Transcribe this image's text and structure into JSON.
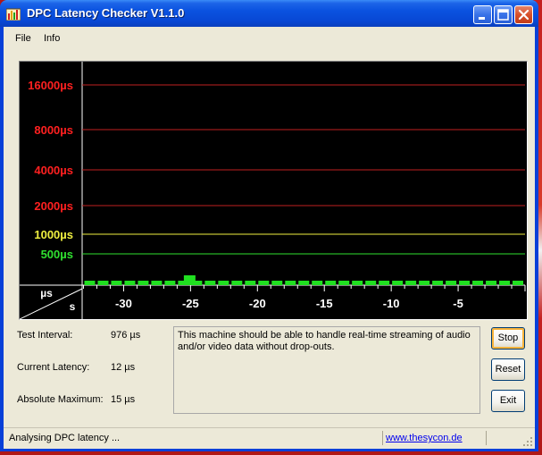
{
  "window": {
    "title": "DPC Latency Checker V1.1.0",
    "controls": [
      "minimize",
      "maximize",
      "close"
    ]
  },
  "menu": {
    "items": [
      {
        "label": "File"
      },
      {
        "label": "Info"
      }
    ]
  },
  "graph": {
    "y_levels": [
      {
        "label": "16000µs",
        "color": "#ff2020",
        "line": "#c02020"
      },
      {
        "label": "8000µs",
        "color": "#ff2020",
        "line": "#c02020"
      },
      {
        "label": "4000µs",
        "color": "#ff2020",
        "line": "#c02020"
      },
      {
        "label": "2000µs",
        "color": "#ff2020",
        "line": "#c02020"
      },
      {
        "label": "1000µs",
        "color": "#f0f040",
        "line": "#f0f040"
      },
      {
        "label": "500µs",
        "color": "#30e030",
        "line": "#30e030"
      }
    ],
    "unit_y": "µs",
    "unit_x": "s",
    "x_ticks": [
      "-30",
      "-25",
      "-20",
      "-15",
      "-10",
      "-5"
    ],
    "bar_color": "#20e020",
    "spike_time_s": -25.5
  },
  "info": {
    "test_interval_label": "Test Interval:",
    "test_interval_value": "976 µs",
    "current_latency_label": "Current Latency:",
    "current_latency_value": "12 µs",
    "absolute_max_label": "Absolute Maximum:",
    "absolute_max_value": "15 µs"
  },
  "message": "This machine should be able to handle real-time streaming of audio and/or video data without drop-outs.",
  "buttons": {
    "stop": "Stop",
    "reset": "Reset",
    "exit": "Exit"
  },
  "status": {
    "text": "Analysing DPC latency ...",
    "link": "www.thesycon.de"
  }
}
